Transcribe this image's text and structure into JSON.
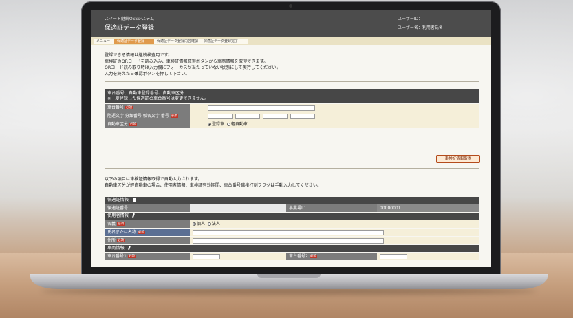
{
  "header": {
    "system_name": "スマート継続OSSシステム",
    "screen_title": "保適証データ登録",
    "user_id_label": "ユーザーID：",
    "user_name_label": "ユーザー名：利用者氏名"
  },
  "breadcrumb": {
    "items": [
      "メニュー",
      "保適証データ登録",
      "保適証データ登録内容確認",
      "保適証データ登録完了"
    ]
  },
  "intro": {
    "lines": [
      "登録できる情報は継続検査用です。",
      "車検証のQRコードを読み込み、車検証情報取得ボタンから車両情報を取得できます。",
      "QRコード読み取り時は入力欄にフォーカスが当たっていない状態にして実行してください。",
      "入力を終えたら確認ボタンを押して下さい。"
    ]
  },
  "vehicle_section": {
    "title_line1": "車台番号、自動車登録番号、自動車区分",
    "title_line2": "※一度登録した保適証の車台番号は変更できません。",
    "chassis_label": "車台番号",
    "plate_label": "陸運文字 分類番号 仮名文字 番号",
    "category_label": "自動車区分",
    "category_options": [
      "登録車",
      "軽自動車"
    ],
    "required_badge": "必須"
  },
  "fetch_button": {
    "label": "車検証情報取得"
  },
  "note2": {
    "lines": [
      "以下の項目は車検証情報取得で自動入力されます。",
      "自動車区分が軽自動車の場合、使用者情報、車検証有効期間、車台番号職権打刻フラグは手動入力してください。"
    ]
  },
  "cert_section": {
    "title": "保適証情報",
    "cert_no_label": "保適証番号",
    "office_id_label": "事業場ID",
    "office_id_value": "00000001"
  },
  "user_section": {
    "title": "使用者情報",
    "type_label": "名義",
    "type_options": [
      "個人",
      "法人"
    ],
    "name_label": "氏名または名称",
    "address_label": "住所"
  },
  "car_section": {
    "title": "車両情報",
    "row1_label": "車台番号1",
    "row1b_label": "車台番号2"
  }
}
